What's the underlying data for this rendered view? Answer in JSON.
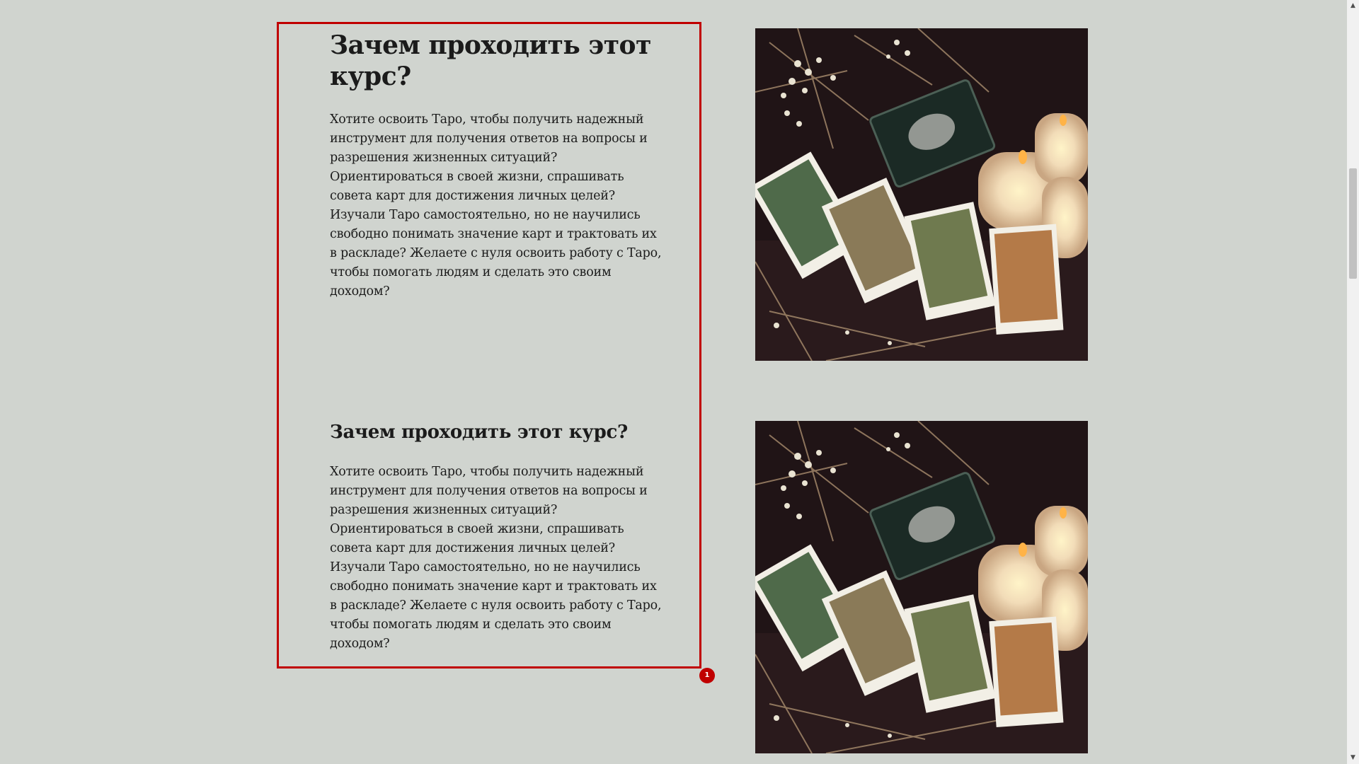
{
  "sections": [
    {
      "heading": "Зачем проходить этот курс?",
      "paragraph": "Хотите освоить Таро, чтобы получить надежный инструмент для получения ответов на вопросы и разрешения жизненных ситуаций? Ориентироваться в своей жизни, спрашивать совета карт для достижения личных целей? Изучали Таро самостоятельно, но не научились свободно понимать значение карт и трактовать их в раскладе? Желаете с нуля освоить работу с Таро, чтобы помогать людям и сделать это своим доходом?"
    },
    {
      "heading": "Зачем проходить этот курс?",
      "paragraph": "Хотите освоить Таро, чтобы получить надежный инструмент для получения ответов на вопросы и разрешения жизненных ситуаций? Ориентироваться в своей жизни, спрашивать совета карт для достижения личных целей? Изучали Таро самостоятельно, но не научились свободно понимать значение карт и трактовать их в раскладе? Желаете с нуля освоить работу с Таро, чтобы помогать людям и сделать это своим доходом?"
    }
  ],
  "highlight": {
    "badge": "1",
    "color": "#c00000"
  },
  "colors": {
    "background": "#d0d4cf",
    "text": "#1b1b1b"
  },
  "icons": {
    "scroll_up": "arrow-up-icon",
    "scroll_down": "arrow-down-icon"
  }
}
